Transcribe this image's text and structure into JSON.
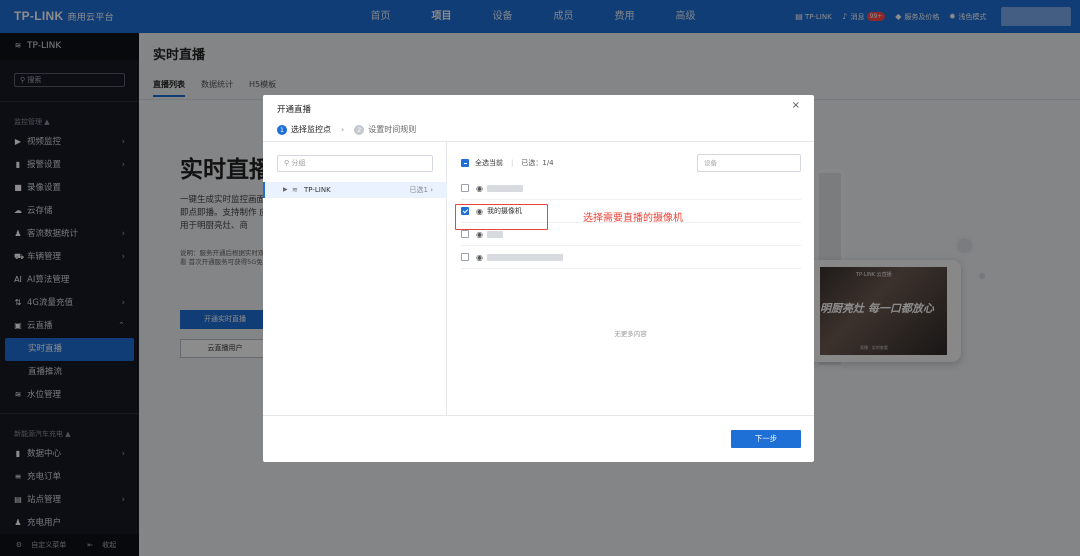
{
  "topbar": {
    "logo": "TP-LINK",
    "logo_sub": "商用云平台",
    "nav": [
      "首页",
      "项目",
      "设备",
      "成员",
      "费用",
      "高级"
    ],
    "active_nav": "项目",
    "right": {
      "org": "TP-LINK",
      "messages": "消息",
      "message_badge": "99+",
      "pricing": "服务及价格",
      "theme": "浅色模式"
    }
  },
  "sidebar": {
    "org": "TP-LINK",
    "search_placeholder": "搜索",
    "group1": "监控管理 ▲",
    "items": [
      {
        "label": "视频监控",
        "icon": "▶",
        "arrow": "›"
      },
      {
        "label": "报警设置",
        "icon": "▮",
        "arrow": "›"
      },
      {
        "label": "录像设置",
        "icon": "■",
        "arrow": ""
      },
      {
        "label": "云存储",
        "icon": "☁",
        "arrow": ""
      },
      {
        "label": "客流数据统计",
        "icon": "♟",
        "arrow": "›"
      },
      {
        "label": "车辆管理",
        "icon": "⛟",
        "arrow": "›"
      },
      {
        "label": "AI算法管理",
        "icon": "AI",
        "arrow": ""
      },
      {
        "label": "4G流量充值",
        "icon": "⇅",
        "arrow": "›"
      },
      {
        "label": "云直播",
        "icon": "▣",
        "arrow": "⌃"
      }
    ],
    "sub_items": [
      "实时直播",
      "直播推流"
    ],
    "water_item": {
      "label": "水位管理",
      "icon": "≋"
    },
    "group2": "新能源汽车充电 ▲",
    "items2": [
      {
        "label": "数据中心",
        "icon": "▮",
        "arrow": "›"
      },
      {
        "label": "充电订单",
        "icon": "≡",
        "arrow": ""
      },
      {
        "label": "站点管理",
        "icon": "▤",
        "arrow": "›"
      },
      {
        "label": "充电用户",
        "icon": "♟",
        "arrow": ""
      }
    ],
    "footer_custom": "自定义菜单",
    "footer_collapse": "收起"
  },
  "page": {
    "title": "实时直播",
    "tabs": [
      "直播列表",
      "数据统计",
      "H5模板"
    ],
    "hero_title": "实时直播",
    "hero_desc": "一键生成实时监控画面 即点即播。支持制作 应用于明厨亮灶、商",
    "hero_note": "说明：服务开通后根据实时观看 首次开通服务可获得5G免",
    "btn_open": "开通实时直播",
    "btn_user": "云直播用户",
    "phone_brand": "TP-LINK 云直播",
    "phone_slogan": "明厨亮灶 每一口都放心",
    "phone_tag": "直播 · 实时查看"
  },
  "modal": {
    "title": "开通直播",
    "close": "×",
    "steps": [
      {
        "num": "1",
        "label": "选择监控点"
      },
      {
        "num": "2",
        "label": "设置时间规则"
      }
    ],
    "step_sep": "›",
    "group_search_placeholder": "分组",
    "tree_node": {
      "label": "TP-LINK",
      "count": "已选1 ›"
    },
    "select_all_label": "全选当前",
    "selected_count": "已选：1/4",
    "device_search_placeholder": "设备",
    "devices": [
      {
        "name": "",
        "checked": false,
        "blur": 36
      },
      {
        "name": "我的摄像机",
        "checked": true,
        "blur": 0
      },
      {
        "name": "",
        "checked": false,
        "blur": 16
      },
      {
        "name": "",
        "checked": false,
        "blur": 76
      }
    ],
    "no_more": "无更多内容",
    "next": "下一步"
  },
  "annotation": "选择需要直播的摄像机",
  "colors": {
    "primary": "#1e6fd6",
    "annotation": "#e8443a",
    "sidebar_bg": "#171b24"
  }
}
